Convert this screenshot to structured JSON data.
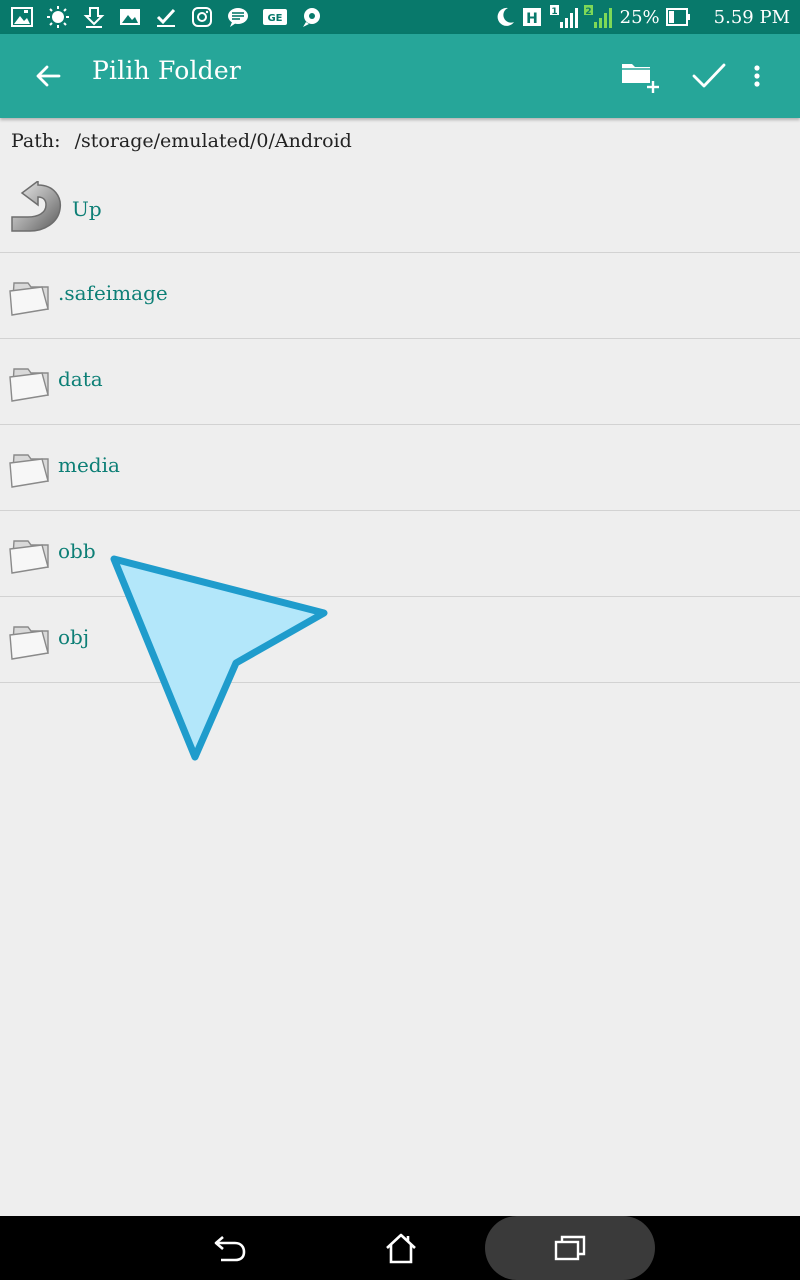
{
  "status_bar": {
    "battery_percent": "25%",
    "time": "5.59 PM",
    "network_label": "H",
    "sim1_label": "1",
    "sim2_label": "2",
    "notification_icons": [
      "gallery-icon",
      "brightness-icon",
      "download-icon",
      "image-icon",
      "checkbox-icon",
      "instagram-icon",
      "message-icon",
      "ge-icon",
      "chat-icon"
    ],
    "background_color": "#08796b"
  },
  "app_bar": {
    "title": "Pilih Folder",
    "background_color": "#26a699"
  },
  "path": {
    "label": "Path:",
    "value": "/storage/emulated/0/Android"
  },
  "folder_list": {
    "up_label": "Up",
    "items": [
      {
        "label": ".safeimage"
      },
      {
        "label": "data"
      },
      {
        "label": "media"
      },
      {
        "label": "obb"
      },
      {
        "label": "obj"
      }
    ],
    "label_color": "#0d7f76"
  },
  "pointer": {
    "fill_color": "#b3e7fa",
    "stroke_color": "#1f9ccc"
  }
}
